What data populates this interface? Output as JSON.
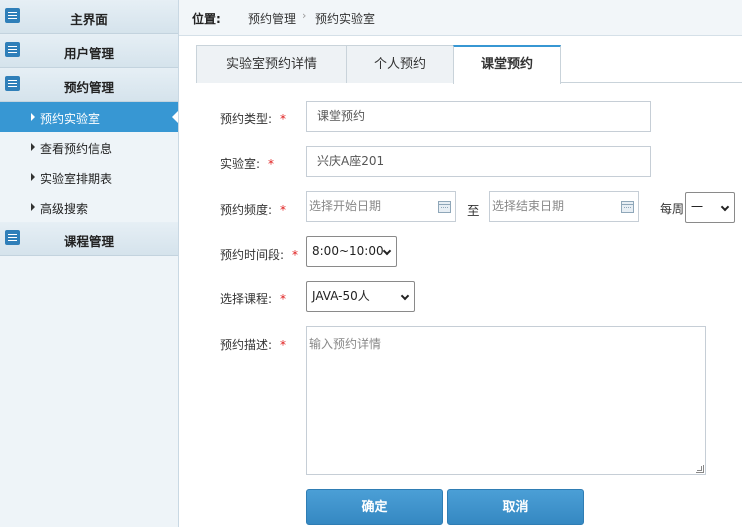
{
  "sidebar": {
    "groups": [
      {
        "label": "主界面"
      },
      {
        "label": "用户管理"
      },
      {
        "label": "预约管理"
      },
      {
        "label": "课程管理"
      }
    ],
    "sub_items": [
      {
        "label": "预约实验室",
        "active": true
      },
      {
        "label": "查看预约信息"
      },
      {
        "label": "实验室排期表"
      },
      {
        "label": "高级搜索"
      }
    ]
  },
  "breadcrumb": {
    "label": "位置:",
    "items": [
      "预约管理",
      "预约实验室"
    ],
    "separator": "›"
  },
  "tabs": [
    {
      "label": "实验室预约详情"
    },
    {
      "label": "个人预约"
    },
    {
      "label": "课堂预约",
      "active": true
    }
  ],
  "form": {
    "required_mark": "*",
    "type": {
      "label": "预约类型:",
      "value": "课堂预约"
    },
    "lab": {
      "label": "实验室:",
      "value": "兴庆A座201"
    },
    "frequency": {
      "label": "预约频度:",
      "start_placeholder": "选择开始日期",
      "to_label": "至",
      "end_placeholder": "选择结束日期",
      "weekly_label": "每周",
      "weekday_value": "一"
    },
    "period": {
      "label": "预约时间段:",
      "value": "8:00~10:00"
    },
    "course": {
      "label": "选择课程:",
      "value": "JAVA-50人"
    },
    "description": {
      "label": "预约描述:",
      "placeholder": "输入预约详情"
    }
  },
  "buttons": {
    "confirm": "确定",
    "cancel": "取消"
  },
  "colors": {
    "accent": "#3797d3",
    "required": "#e02020",
    "icon": "#2f7fb9"
  }
}
